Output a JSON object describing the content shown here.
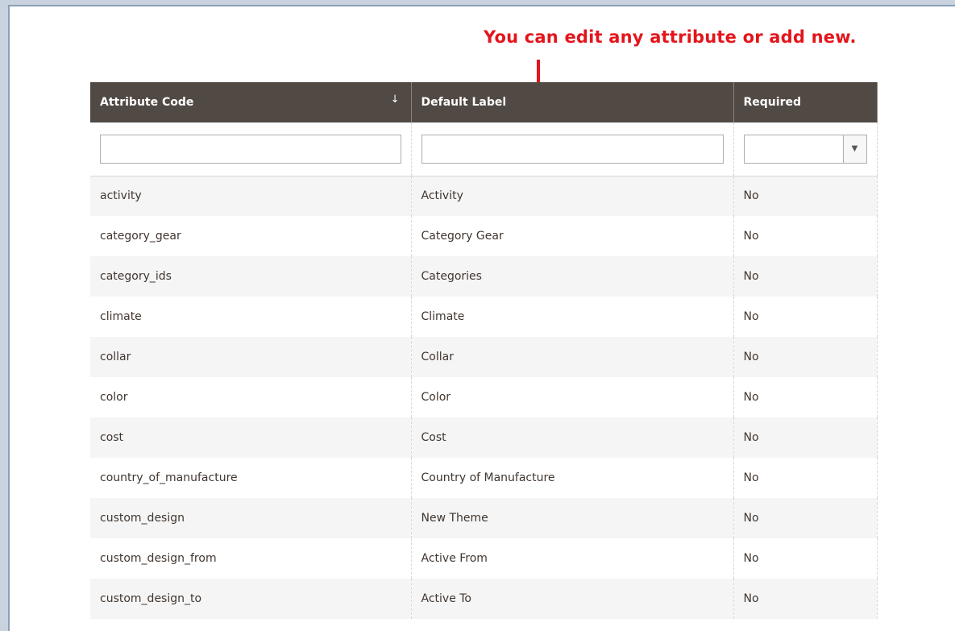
{
  "callout": {
    "text": "You can edit any attribute or add new.",
    "color": "#e3151c"
  },
  "grid": {
    "columns": [
      {
        "label": "Attribute Code",
        "sort_icon": "arrow-down-icon",
        "sort_glyph": "↓"
      },
      {
        "label": "Default Label"
      },
      {
        "label": "Required"
      }
    ],
    "header_color": "#514943",
    "filters": {
      "attribute_code": "",
      "default_label": "",
      "required": "",
      "select_glyph": "▼"
    },
    "rows": [
      {
        "code": "activity",
        "label": "Activity",
        "required": "No"
      },
      {
        "code": "category_gear",
        "label": "Category Gear",
        "required": "No"
      },
      {
        "code": "category_ids",
        "label": "Categories",
        "required": "No"
      },
      {
        "code": "climate",
        "label": "Climate",
        "required": "No"
      },
      {
        "code": "collar",
        "label": "Collar",
        "required": "No"
      },
      {
        "code": "color",
        "label": "Color",
        "required": "No"
      },
      {
        "code": "cost",
        "label": "Cost",
        "required": "No"
      },
      {
        "code": "country_of_manufacture",
        "label": "Country of Manufacture",
        "required": "No"
      },
      {
        "code": "custom_design",
        "label": "New Theme",
        "required": "No"
      },
      {
        "code": "custom_design_from",
        "label": "Active From",
        "required": "No"
      },
      {
        "code": "custom_design_to",
        "label": "Active To",
        "required": "No"
      }
    ]
  }
}
